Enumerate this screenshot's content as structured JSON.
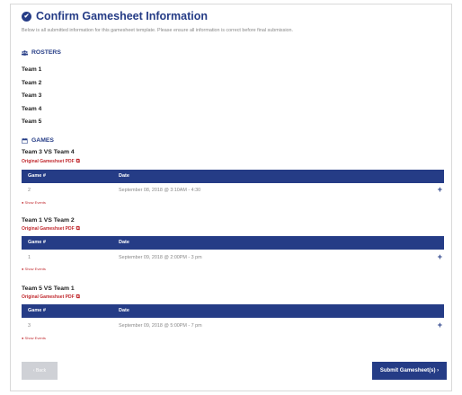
{
  "header": {
    "title": "Confirm Gamesheet Information",
    "subtitle": "Below is all submitted information for this gamesheet template. Please ensure all information is correct before final submission."
  },
  "rosters": {
    "heading": "ROSTERS",
    "teams": [
      "Team 1",
      "Team 2",
      "Team 3",
      "Team 4",
      "Team 5"
    ]
  },
  "games": {
    "heading": "GAMES",
    "columns": {
      "game": "Game #",
      "date": "Date"
    },
    "pdf_label": "Original Gameshset PDF",
    "show_events": "● Show Events",
    "list": [
      {
        "title": "Team 3 VS Team 4",
        "game_number": "2",
        "date": "September 08, 2018 @ 3:10AM - 4:30"
      },
      {
        "title": "Team 1 VS Team 2",
        "game_number": "1",
        "date": "September 09, 2018 @ 2:00PM - 3 pm"
      },
      {
        "title": "Team 5 VS Team 1",
        "game_number": "3",
        "date": "September 09, 2018 @ 5:00PM - 7 pm"
      }
    ]
  },
  "actions": {
    "back_label": "‹ Back",
    "submit_label": "Submit Gamesheet(s) ›"
  },
  "colors": {
    "primary": "#253c86",
    "link": "#c0282d",
    "muted": "#888888",
    "disabled": "#cfd1d6"
  }
}
